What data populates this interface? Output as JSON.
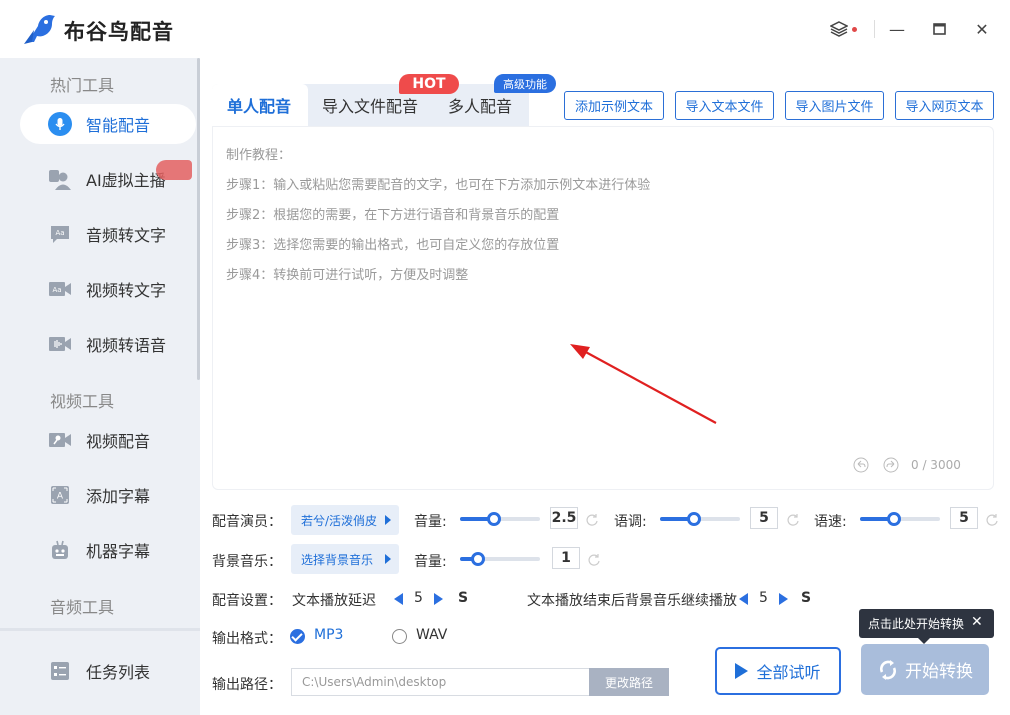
{
  "app": {
    "title": "布谷鸟配音",
    "colors": {
      "accent": "#2b6fe0",
      "hot": "#ef4b4b",
      "sidebar_bg": "#edf0f5",
      "start_disabled": "#a9bddb"
    },
    "window_controls": {
      "layers_icon": "layers-icon",
      "minimize": "—",
      "maximize": "☐",
      "close": "✕"
    }
  },
  "sidebar": {
    "sections": [
      {
        "title": "热门工具"
      },
      {
        "title": "视频工具"
      },
      {
        "title": "音频工具"
      }
    ],
    "items": [
      {
        "label": "智能配音",
        "icon": "mic-icon",
        "active": true
      },
      {
        "label": "AI虚拟主播",
        "icon": "anchor-icon"
      },
      {
        "label": "音频转文字",
        "icon": "audio-text-icon"
      },
      {
        "label": "视频转文字",
        "icon": "video-text-icon"
      },
      {
        "label": "视频转语音",
        "icon": "video-voice-icon"
      },
      {
        "label": "视频配音",
        "icon": "video-dub-icon"
      },
      {
        "label": "添加字幕",
        "icon": "subtitle-icon"
      },
      {
        "label": "机器字幕",
        "icon": "robot-icon"
      }
    ],
    "task_list": {
      "label": "任务列表",
      "icon": "task-list-icon"
    }
  },
  "tabs": [
    {
      "label": "单人配音",
      "active": true
    },
    {
      "label": "导入文件配音"
    },
    {
      "label": "多人配音"
    }
  ],
  "badges": {
    "hot": "HOT",
    "advanced": "高级功能"
  },
  "toolbar": {
    "add_example": "添加示例文本",
    "import_text": "导入文本文件",
    "import_image": "导入图片文件",
    "import_web": "导入网页文本"
  },
  "editor": {
    "lines": [
      "制作教程：",
      "步骤1：输入或粘贴您需要配音的文字，也可在下方添加示例文本进行体验",
      "步骤2：根据您的需要，在下方进行语音和背景音乐的配置",
      "步骤3：选择您需要的输出格式，也可自定义您的存放位置",
      "步骤4：转换前可进行试听，方便及时调整"
    ],
    "counter": "0 / 3000"
  },
  "settings": {
    "voice": {
      "label": "配音演员：",
      "value": "若兮/活泼俏皮",
      "volume_label": "音量:",
      "volume": "2.5",
      "volume_fraction": 0.43,
      "pitch_label": "语调:",
      "pitch": "5",
      "pitch_fraction": 0.43,
      "speed_label": "语速:",
      "speed": "5",
      "speed_fraction": 0.43
    },
    "bgm": {
      "label": "背景音乐：",
      "value": "选择背景音乐",
      "volume_label": "音量:",
      "volume": "1",
      "volume_fraction": 0.22
    },
    "dub": {
      "label": "配音设置：",
      "delay_label": "文本播放延迟",
      "delay_value": "5",
      "delay_unit": "S",
      "continue_label": "文本播放结束后背景音乐继续播放",
      "continue_value": "5",
      "continue_unit": "S"
    },
    "format": {
      "label": "输出格式：",
      "options": [
        {
          "label": "MP3",
          "checked": true
        },
        {
          "label": "WAV",
          "checked": false
        }
      ]
    },
    "path": {
      "label": "输出路径：",
      "value": "C:\\Users\\Admin\\desktop",
      "button": "更改路径"
    }
  },
  "actions": {
    "listen_all": "全部试听",
    "start": "开始转换",
    "tooltip": "点击此处开始转换"
  }
}
